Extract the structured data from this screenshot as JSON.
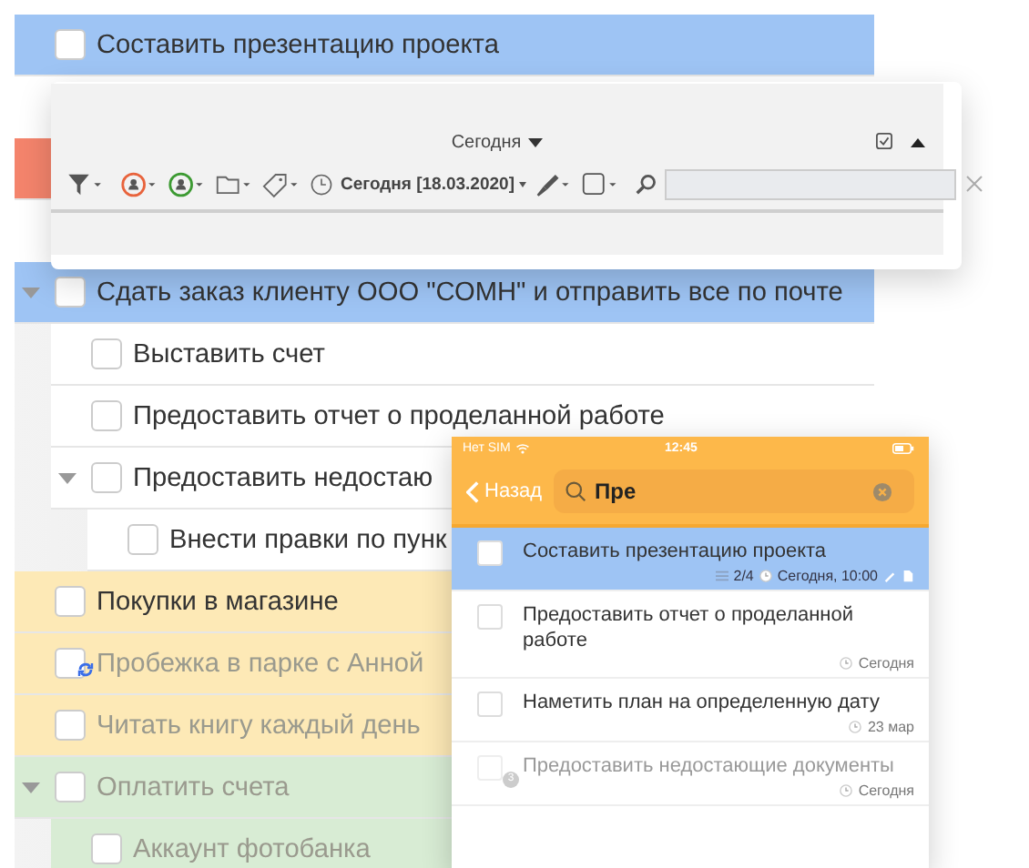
{
  "tasks": [
    {
      "title": "Составить презентацию проекта",
      "color": "#9ec4f4",
      "checked": false,
      "dimmed": false
    },
    {
      "color": "#f4846c"
    },
    {
      "title": "Сдать заказ клиенту ООО \"СОМН\" и отправить все по почте",
      "color": "#9ec4f4",
      "checked": false,
      "dimmed": false,
      "expanded": true,
      "children": [
        {
          "title": "Выставить счет",
          "color": "#ffffff",
          "checked": false,
          "dimmed": false
        },
        {
          "title": "Предоставить отчет о проделанной работе",
          "color": "#ffffff",
          "checked": false,
          "dimmed": false
        },
        {
          "title": "Предоставить недостаю",
          "color": "#ffffff",
          "checked": false,
          "dimmed": false,
          "expanded": true,
          "children": [
            {
              "title": "Внести правки по пунк",
              "color": "#ffffff",
              "checked": false,
              "dimmed": false
            }
          ]
        }
      ]
    },
    {
      "title": "Покупки в магазине",
      "color": "#fde9b6",
      "checked": false,
      "dimmed": false
    },
    {
      "title": "Пробежка в парке с Анной",
      "color": "#fde9b6",
      "checked": false,
      "dimmed": true,
      "repeat": true
    },
    {
      "title": "Читать книгу каждый день",
      "color": "#fde9b6",
      "checked": false,
      "dimmed": true
    },
    {
      "title": "Оплатить счета",
      "color": "#d8ecd4",
      "checked": false,
      "dimmed": true,
      "expanded": true,
      "children": [
        {
          "title": "Аккаунт фотобанка",
          "color": "#d8ecd4",
          "checked": false,
          "dimmed": true
        }
      ]
    }
  ],
  "filter_bar": {
    "period": "Сегодня",
    "date_filter": "Сегодня [18.03.2020]"
  },
  "mobile": {
    "carrier": "Нет SIM",
    "time": "12:45",
    "back": "Назад",
    "search": "Пре",
    "tasks": [
      {
        "title": "Составить презентацию проекта",
        "selected": true,
        "checked": false,
        "dimmed": false,
        "subtasks": "2/4",
        "due": "Сегодня, 10:00",
        "edited": true,
        "note": true
      },
      {
        "title": "Предоставить отчет о проделанной работе",
        "selected": false,
        "checked": false,
        "dimmed": false,
        "due": "Сегодня"
      },
      {
        "title": "Наметить план на определенную дату",
        "selected": false,
        "checked": false,
        "dimmed": false,
        "due": "23 мар"
      },
      {
        "title": "Предоставить недостающие документы",
        "selected": false,
        "checked": false,
        "dimmed": true,
        "badge": "3",
        "due": "Сегодня"
      }
    ]
  }
}
